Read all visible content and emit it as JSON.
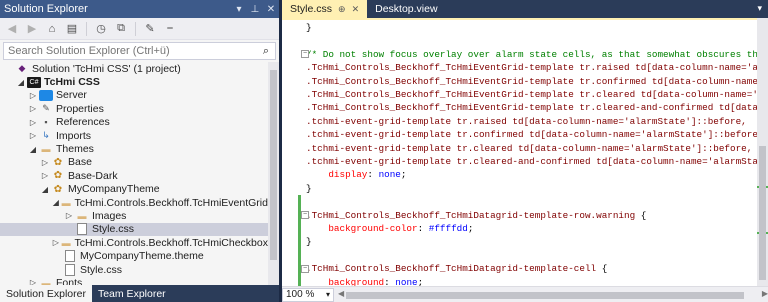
{
  "solution_explorer": {
    "title": "Solution Explorer",
    "search_placeholder": "Search Solution Explorer (Ctrl+ü)",
    "tree": [
      {
        "label": "Solution 'TcHmi CSS' (1 project)",
        "indent": 0,
        "arrow": "",
        "icon": "solution-icon",
        "bold": false
      },
      {
        "label": "TcHmi CSS",
        "indent": 1,
        "arrow": "◢",
        "icon": "project-icon",
        "bold": true
      },
      {
        "label": "Server",
        "indent": 2,
        "arrow": "▷",
        "icon": "server-icon",
        "bold": false
      },
      {
        "label": "Properties",
        "indent": 2,
        "arrow": "▷",
        "icon": "wrench-icon",
        "bold": false
      },
      {
        "label": "References",
        "indent": 2,
        "arrow": "▷",
        "icon": "references-icon",
        "bold": false
      },
      {
        "label": "Imports",
        "indent": 2,
        "arrow": "▷",
        "icon": "imports-icon",
        "bold": false
      },
      {
        "label": "Themes",
        "indent": 2,
        "arrow": "◢",
        "icon": "folder-icon",
        "bold": false
      },
      {
        "label": "Base",
        "indent": 3,
        "arrow": "▷",
        "icon": "theme-icon",
        "bold": false
      },
      {
        "label": "Base-Dark",
        "indent": 3,
        "arrow": "▷",
        "icon": "theme-icon",
        "bold": false
      },
      {
        "label": "MyCompanyTheme",
        "indent": 3,
        "arrow": "◢",
        "icon": "theme-icon",
        "bold": false
      },
      {
        "label": "TcHmi.Controls.Beckhoff.TcHmiEventGrid",
        "indent": 4,
        "arrow": "◢",
        "icon": "folder-icon",
        "bold": false
      },
      {
        "label": "Images",
        "indent": 5,
        "arrow": "▷",
        "icon": "folder-icon",
        "bold": false
      },
      {
        "label": "Style.css",
        "indent": 5,
        "arrow": "",
        "icon": "css-file-icon",
        "bold": false,
        "selected": true
      },
      {
        "label": "TcHmi.Controls.Beckhoff.TcHmiCheckbox",
        "indent": 4,
        "arrow": "▷",
        "icon": "folder-icon",
        "bold": false
      },
      {
        "label": "MyCompanyTheme.theme",
        "indent": 4,
        "arrow": "",
        "icon": "file-icon",
        "bold": false
      },
      {
        "label": "Style.css",
        "indent": 4,
        "arrow": "",
        "icon": "css-file-icon",
        "bold": false
      },
      {
        "label": "Fonts",
        "indent": 2,
        "arrow": "▷",
        "icon": "folder-icon",
        "bold": false
      }
    ],
    "bottom_tabs": [
      "Solution Explorer",
      "Team Explorer"
    ]
  },
  "editor": {
    "tabs": [
      {
        "label": "Style.css",
        "active": true
      },
      {
        "label": "Desktop.view",
        "active": false
      }
    ],
    "zoom": "100 %",
    "lines": [
      [
        {
          "t": "}",
          "c": "pun"
        }
      ],
      [],
      [
        {
          "t": "/* Do not show focus overlay over alarm state cells, as that somewhat obscures the colo",
          "c": "cmt"
        }
      ],
      [
        {
          "t": ".TcHmi_Controls_Beckhoff_TcHmiEventGrid-template tr.raised td[data-column-name='alarmSt",
          "c": "sel"
        }
      ],
      [
        {
          "t": ".TcHmi_Controls_Beckhoff_TcHmiEventGrid-template tr.confirmed td[data-column-name='alar",
          "c": "sel"
        }
      ],
      [
        {
          "t": ".TcHmi_Controls_Beckhoff_TcHmiEventGrid-template tr.cleared td[data-column-name='alarmS",
          "c": "sel"
        }
      ],
      [
        {
          "t": ".TcHmi_Controls_Beckhoff_TcHmiEventGrid-template tr.cleared-and-confirmed td[data-colum",
          "c": "sel"
        }
      ],
      [
        {
          "t": ".tchmi-event-grid-template tr.raised td[data-column-name='alarmState']::before,",
          "c": "sel"
        }
      ],
      [
        {
          "t": ".tchmi-event-grid-template tr.confirmed td[data-column-name='alarmState']::before,",
          "c": "sel"
        }
      ],
      [
        {
          "t": ".tchmi-event-grid-template tr.cleared td[data-column-name='alarmState']::before,",
          "c": "sel"
        }
      ],
      [
        {
          "t": ".tchmi-event-grid-template tr.cleared-and-confirmed td[data-column-name='alarmState']::",
          "c": "sel"
        }
      ],
      [
        {
          "t": "    ",
          "c": "pun"
        },
        {
          "t": "display",
          "c": "prop"
        },
        {
          "t": ": ",
          "c": "pun"
        },
        {
          "t": "none",
          "c": "val"
        },
        {
          "t": ";",
          "c": "pun"
        }
      ],
      [
        {
          "t": "}",
          "c": "pun"
        }
      ],
      [],
      [
        {
          "t": ".TcHmi_Controls_Beckhoff_TcHmiDatagrid-template-row.warning",
          "c": "sel"
        },
        {
          "t": " {",
          "c": "pun"
        }
      ],
      [
        {
          "t": "    ",
          "c": "pun"
        },
        {
          "t": "background-color",
          "c": "prop"
        },
        {
          "t": ": ",
          "c": "pun"
        },
        {
          "t": "#ffffdd",
          "c": "val"
        },
        {
          "t": ";",
          "c": "pun"
        }
      ],
      [
        {
          "t": "}",
          "c": "pun"
        }
      ],
      [],
      [
        {
          "t": ".TcHmi_Controls_Beckhoff_TcHmiDatagrid-template-cell",
          "c": "sel"
        },
        {
          "t": " {",
          "c": "pun"
        }
      ],
      [
        {
          "t": "    ",
          "c": "pun"
        },
        {
          "t": "background",
          "c": "prop"
        },
        {
          "t": ": ",
          "c": "pun"
        },
        {
          "t": "none",
          "c": "val"
        },
        {
          "t": ";",
          "c": "pun"
        }
      ],
      [
        {
          "t": "}",
          "c": "pun"
        }
      ]
    ]
  }
}
